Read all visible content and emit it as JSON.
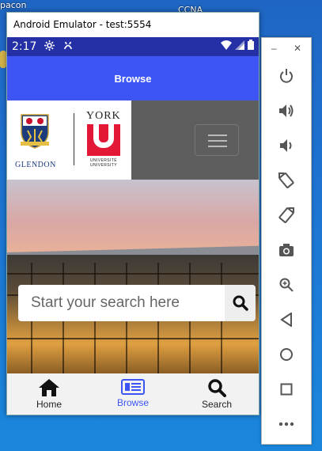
{
  "desktop": {
    "label_left": "pacon",
    "label_right": "CCNA"
  },
  "emulator": {
    "window_title": "Android Emulator - test:5554"
  },
  "status_bar": {
    "time": "2:17"
  },
  "app_bar": {
    "title": "Browse"
  },
  "site": {
    "logo_left_text": "GLENDON",
    "logo_right_title": "YORK",
    "logo_right_sub1": "UNIVERSITÉ",
    "logo_right_sub2": "UNIVERSITY"
  },
  "search": {
    "placeholder": "Start your search here"
  },
  "bottom_nav": {
    "items": [
      {
        "label": "Home",
        "icon": "home-icon"
      },
      {
        "label": "Browse",
        "icon": "browse-icon",
        "active": true
      },
      {
        "label": "Search",
        "icon": "search-icon"
      }
    ]
  },
  "colors": {
    "status_bar": "#2530a6",
    "app_bar": "#3d55f5",
    "active_nav": "#3d55f5"
  }
}
